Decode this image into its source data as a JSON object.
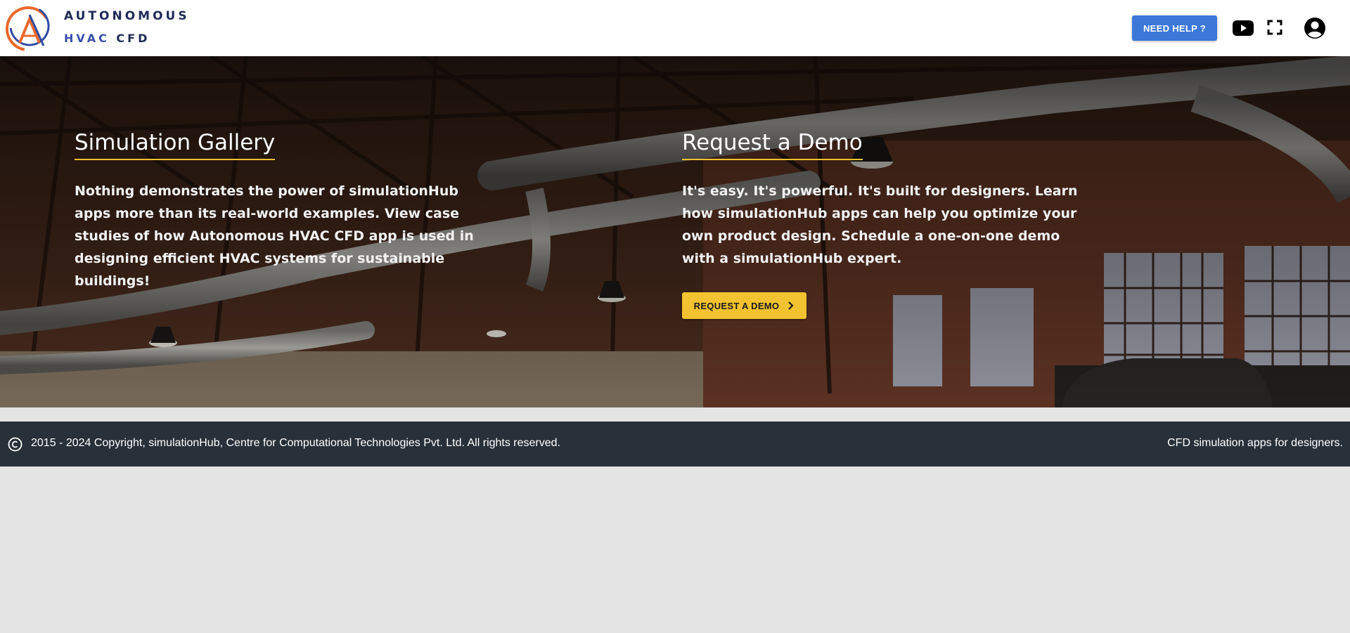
{
  "brand": {
    "line1": "AUTONOMOUS",
    "line2_a": "HVAC",
    "line2_b": "CFD"
  },
  "header": {
    "help_label": "NEED HELP ?",
    "icons": [
      "youtube-icon",
      "fullscreen-icon",
      "account-circle-icon"
    ]
  },
  "gallery": {
    "title": "Simulation Gallery",
    "text_a": "Nothing demonstrates the power of simulationHub apps more than its real-world examples. View case studies of how ",
    "text_b": "Autonomous HVAC CFD",
    "text_c": " app is used in designing efficient HVAC systems for sustainable buildings!"
  },
  "demo": {
    "title": "Request a Demo",
    "text": "It's easy. It's powerful. It's built for designers. Learn how simulationHub apps can help you optimize your own product design. Schedule a one-on-one demo with a simulationHub expert.",
    "button_label": "REQUEST A DEMO"
  },
  "footer": {
    "copyright": "2015 - 2024 Copyright, simulationHub, Centre for Computational Technologies Pvt. Ltd. All rights reserved.",
    "tagline": "CFD simulation apps for designers."
  },
  "colors": {
    "accent_yellow": "#f2c230",
    "help_blue": "#3b78d8",
    "footer_bg": "#283139",
    "page_bg": "#e4e4e4"
  }
}
